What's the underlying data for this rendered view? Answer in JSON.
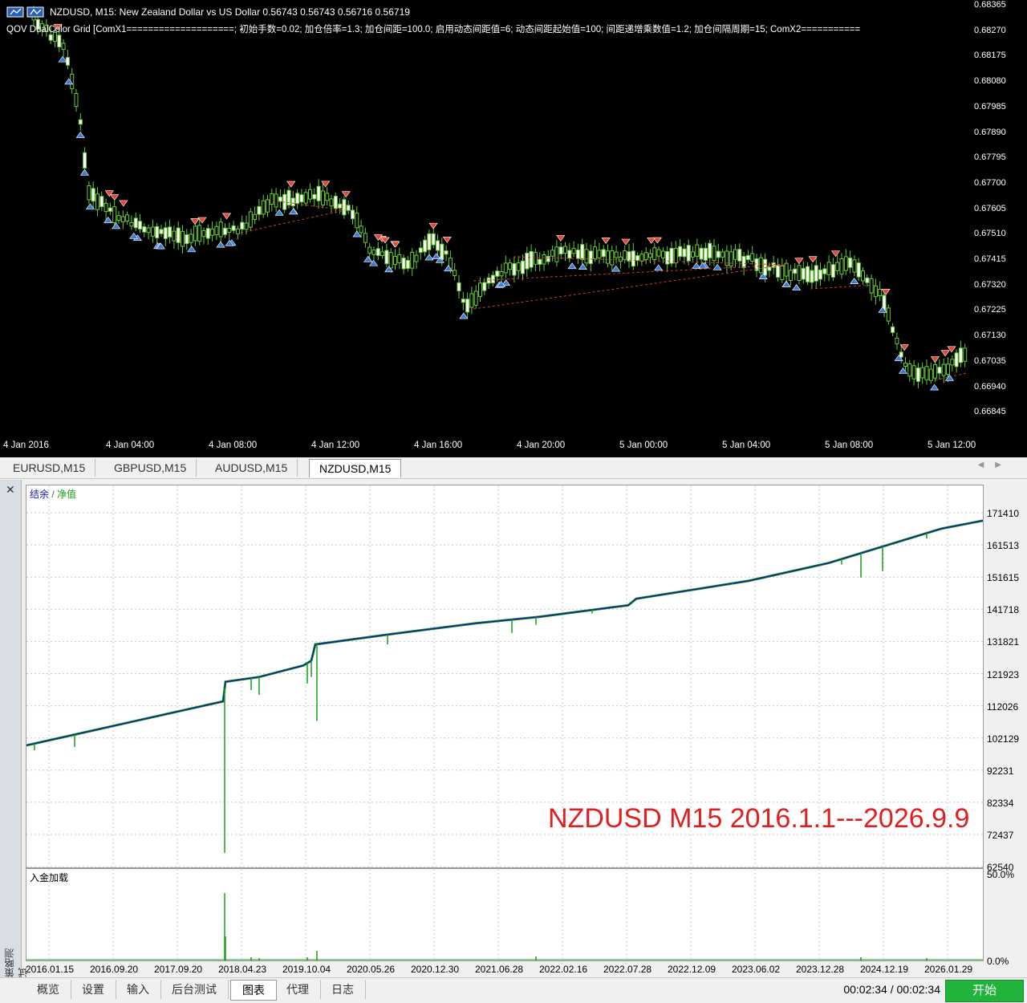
{
  "price_chart": {
    "title": "NZDUSD, M15:  New Zealand Dollar vs US Dollar  0.56743 0.56743 0.56716 0.56719",
    "indicator": "QOV DualColor Grid [ComX1====================; 初始手数=0.02; 加仓倍率=1.3; 加仓间距=100.0; 启用动态间距值=6; 动态间距起始值=100; 间距递增乘数值=1.2; 加仓间隔周期=15; ComX2===========",
    "y_ticks": [
      "0.68365",
      "0.68270",
      "0.68175",
      "0.68080",
      "0.67985",
      "0.67890",
      "0.67795",
      "0.67700",
      "0.67605",
      "0.67510",
      "0.67415",
      "0.67320",
      "0.67225",
      "0.67130",
      "0.67035",
      "0.66940",
      "0.66845"
    ],
    "x_ticks": [
      "4 Jan 2016",
      "4 Jan 04:00",
      "4 Jan 08:00",
      "4 Jan 12:00",
      "4 Jan 16:00",
      "4 Jan 20:00",
      "5 Jan 00:00",
      "5 Jan 04:00",
      "5 Jan 08:00",
      "5 Jan 12:00"
    ],
    "colors": {
      "background": "#000000",
      "up": "#66cc33",
      "sell_arrow": "#e8452e",
      "buy_arrow": "#3a7bd5",
      "grid_line": "#d03a2a"
    }
  },
  "symbol_tabs": [
    {
      "label": "EURUSD,M15",
      "active": false
    },
    {
      "label": "GBPUSD,M15",
      "active": false
    },
    {
      "label": "AUDUSD,M15",
      "active": false
    },
    {
      "label": "NZDUSD,M15",
      "active": true
    }
  ],
  "tester": {
    "side_label": "策略测试",
    "legend_balance": "结余",
    "legend_sep": " / ",
    "legend_equity": "净值",
    "deposit_label": "入金加载",
    "annotation": "NZDUSD M15 2016.1.1---2026.9.9",
    "equity_ticks": [
      "171410",
      "161513",
      "151615",
      "141718",
      "131821",
      "121923",
      "112026",
      "102129",
      "92231",
      "82334",
      "72437",
      "62540"
    ],
    "deposit_ticks": [
      "50.0%",
      "0.0%"
    ],
    "dates": [
      "2016.01.15",
      "2016.09.20",
      "2017.09.20",
      "2018.04.23",
      "2019.10.04",
      "2020.05.26",
      "2020.12.30",
      "2021.06.28",
      "2022.02.16",
      "2022.07.28",
      "2022.12.09",
      "2023.06.02",
      "2023.12.28",
      "2024.12.19",
      "2026.01.29"
    ],
    "colors": {
      "balance": "#1a1aa8",
      "equity": "#16a016",
      "grid": "#c8c8c8"
    }
  },
  "bottom_tabs": [
    {
      "label": "概览",
      "active": false
    },
    {
      "label": "设置",
      "active": false
    },
    {
      "label": "输入",
      "active": false
    },
    {
      "label": "后台测试",
      "active": false
    },
    {
      "label": "图表",
      "active": true
    },
    {
      "label": "代理",
      "active": false
    },
    {
      "label": "日志",
      "active": false
    }
  ],
  "status": {
    "timer": "00:02:34 / 00:02:34",
    "start_label": "开始"
  }
}
